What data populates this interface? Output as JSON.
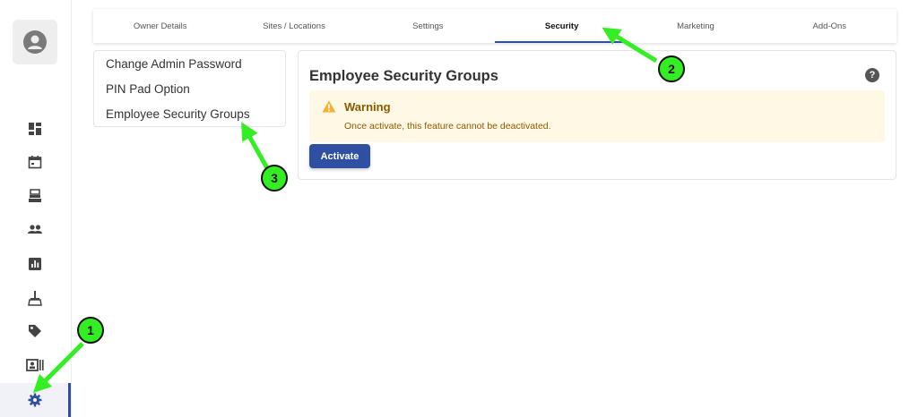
{
  "tabs": [
    {
      "label": "Owner Details"
    },
    {
      "label": "Sites / Locations"
    },
    {
      "label": "Settings"
    },
    {
      "label": "Security",
      "active": true
    },
    {
      "label": "Marketing"
    },
    {
      "label": "Add-Ons"
    }
  ],
  "submenu": {
    "items": [
      {
        "label": "Change Admin Password"
      },
      {
        "label": "PIN Pad Option"
      },
      {
        "label": "Employee Security Groups"
      }
    ]
  },
  "panel": {
    "title": "Employee Security Groups",
    "help_icon": "?",
    "warning": {
      "title": "Warning",
      "text": "Once activate, this feature cannot be deactivated."
    },
    "activate_label": "Activate"
  },
  "sidebar": {
    "icons": [
      "avatar-icon",
      "dashboard-icon",
      "calendar-icon",
      "register-icon",
      "users-icon",
      "report-icon",
      "cleaning-icon",
      "tag-icon",
      "id-card-icon",
      "gear-icon"
    ]
  },
  "annotations": {
    "badges": [
      "1",
      "2",
      "3"
    ],
    "color": "#33ee22"
  },
  "colors": {
    "accent": "#2f4fa3",
    "warning_bg": "#fff8e5",
    "warning_text": "#8a5a00"
  }
}
